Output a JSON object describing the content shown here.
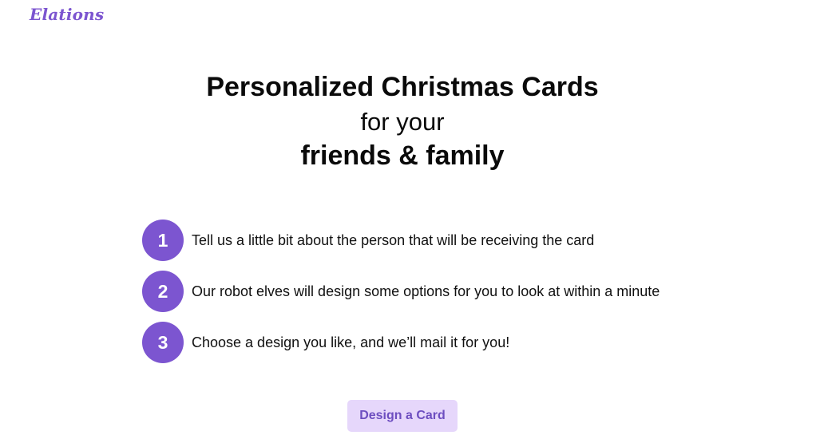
{
  "header": {
    "logo_text": "Elations"
  },
  "hero": {
    "line1": "Personalized Christmas Cards",
    "line2": "for your",
    "line3": "friends & family"
  },
  "steps": [
    {
      "number": "1",
      "text": "Tell us a little bit about the person that will be receiving the card"
    },
    {
      "number": "2",
      "text": "Our robot elves will design some options for you to look at within a minute"
    },
    {
      "number": "3",
      "text": "Choose a design you like, and we’ll mail it for you!"
    }
  ],
  "cta": {
    "label": "Design a Card"
  },
  "colors": {
    "accent": "#7c55d0",
    "button_bg": "#e6d7fb",
    "button_text": "#6d4ec0"
  }
}
